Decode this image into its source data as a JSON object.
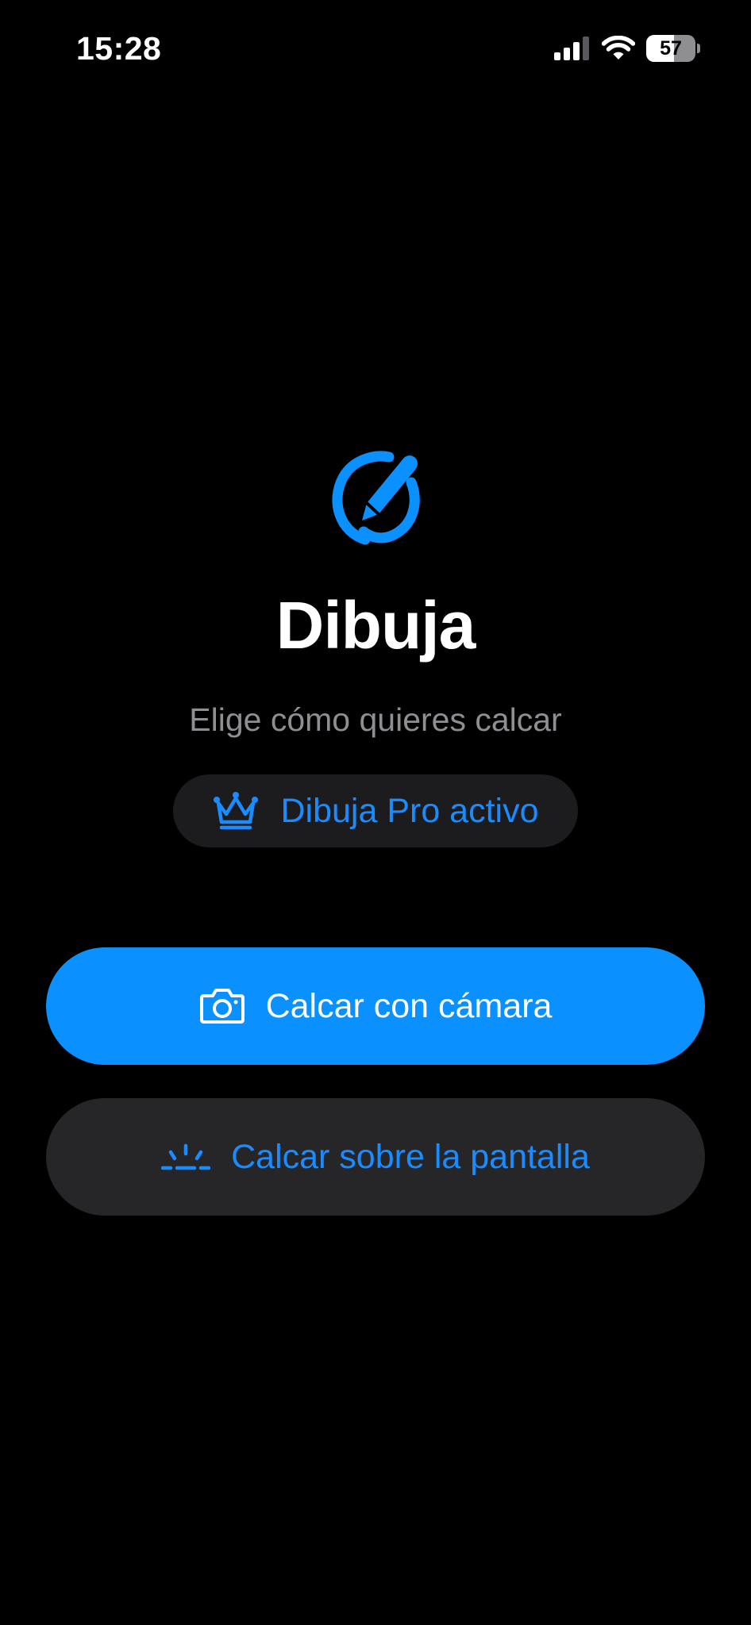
{
  "status_bar": {
    "time": "15:28",
    "battery_percent": "57",
    "battery_level": 0.57,
    "icons": [
      "cellular-signal-icon",
      "wifi-icon",
      "battery-icon"
    ]
  },
  "app": {
    "logo_icon": "pencil-circle-icon",
    "title": "Dibuja",
    "subtitle": "Elige cómo quieres calcar"
  },
  "pro_badge": {
    "icon": "crown-icon",
    "label": "Dibuja Pro activo"
  },
  "actions": {
    "camera": {
      "icon": "camera-icon",
      "label": "Calcar con cámara"
    },
    "screen": {
      "icon": "light-rays-icon",
      "label": "Calcar sobre la pantalla"
    }
  },
  "colors": {
    "background": "#000000",
    "accent": "#0a91ff",
    "accent_text": "#1a8cff",
    "secondary_text": "#8e8e93",
    "surface": "#1c1c1e",
    "surface_button": "#262628"
  }
}
